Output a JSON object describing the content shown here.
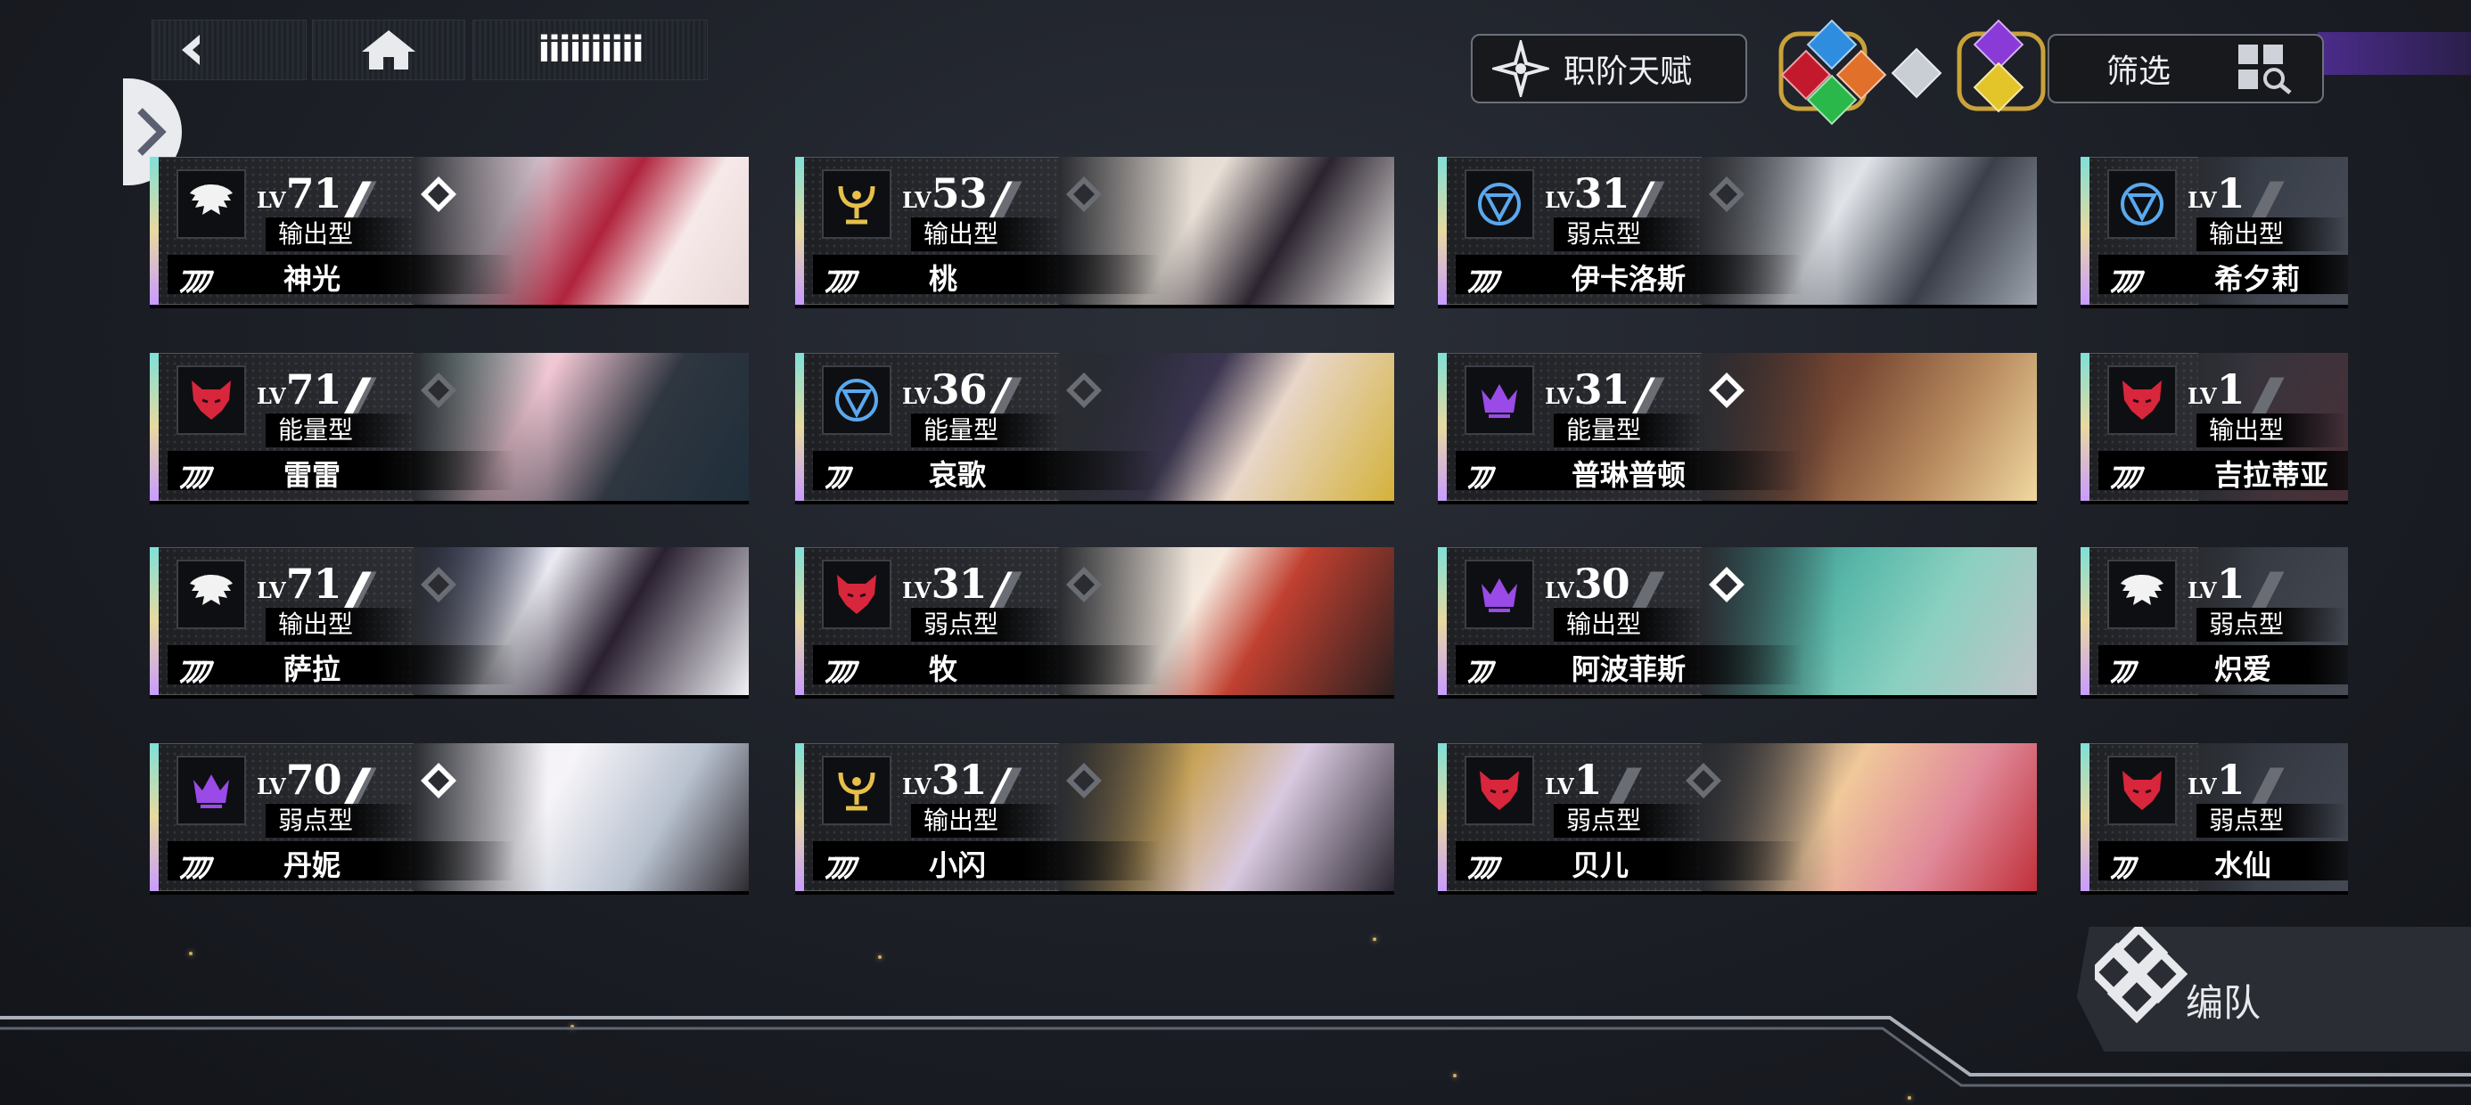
{
  "nav": {
    "title": "iiiiiiiiii"
  },
  "top": {
    "talent_label": "职阶天赋",
    "filter_label": "筛选"
  },
  "colors": {
    "rank_on": "#ffffff",
    "rank_off": "#6a6d74",
    "accent_purple": "#4c2c8c"
  },
  "elements": [
    "red-wolf-gem",
    "blue-gem",
    "orange-gem",
    "green-gem",
    "white-gem",
    "purple-gem",
    "yellow-gem"
  ],
  "cards": [
    {
      "lv_prefix": "LV",
      "level": "71",
      "role": "输出型",
      "name": "神光",
      "emblem": "wing-icon",
      "stars": "ﾌﾌﾌﾌ",
      "rank_on": 2,
      "rank": "filled"
    },
    {
      "lv_prefix": "LV",
      "level": "53",
      "role": "输出型",
      "name": "桃",
      "emblem": "chalice-icon",
      "stars": "ﾌﾌﾌﾌ",
      "rank_on": 1,
      "rank": "gray"
    },
    {
      "lv_prefix": "LV",
      "level": "31",
      "role": "弱点型",
      "name": "伊卡洛斯",
      "emblem": "shield-icon",
      "stars": "ﾌﾌﾌﾌ",
      "rank_on": 1,
      "rank": "gray"
    },
    {
      "lv_prefix": "LV",
      "level": "1",
      "role": "输出型",
      "name": "希夕莉",
      "emblem": "shield-icon",
      "stars": "ﾌﾌﾌﾌ",
      "rank_on": 0,
      "rank": "none"
    },
    {
      "lv_prefix": "LV",
      "level": "71",
      "role": "能量型",
      "name": "雷雷",
      "emblem": "wolf-icon",
      "stars": "ﾌﾌﾌﾌ",
      "rank_on": 2,
      "rank": "gray"
    },
    {
      "lv_prefix": "LV",
      "level": "36",
      "role": "能量型",
      "name": "哀歌",
      "emblem": "shield-icon",
      "stars": "ﾌﾌﾌ",
      "rank_on": 1,
      "rank": "gray"
    },
    {
      "lv_prefix": "LV",
      "level": "31",
      "role": "能量型",
      "name": "普琳普顿",
      "emblem": "crown-icon",
      "stars": "ﾌﾌﾌ",
      "rank_on": 1,
      "rank": "filled"
    },
    {
      "lv_prefix": "LV",
      "level": "1",
      "role": "输出型",
      "name": "吉拉蒂亚",
      "emblem": "wolf-icon",
      "stars": "ﾌﾌﾌﾌ",
      "rank_on": 0,
      "rank": "none"
    },
    {
      "lv_prefix": "LV",
      "level": "71",
      "role": "输出型",
      "name": "萨拉",
      "emblem": "wing-icon",
      "stars": "ﾌﾌﾌﾌ",
      "rank_on": 2,
      "rank": "gray"
    },
    {
      "lv_prefix": "LV",
      "level": "31",
      "role": "弱点型",
      "name": "牧",
      "emblem": "wolf-icon",
      "stars": "ﾌﾌﾌﾌ",
      "rank_on": 1,
      "rank": "gray"
    },
    {
      "lv_prefix": "LV",
      "level": "30",
      "role": "输出型",
      "name": "阿波菲斯",
      "emblem": "crown-icon",
      "stars": "ﾌﾌﾌ",
      "rank_on": 0,
      "rank": "filled"
    },
    {
      "lv_prefix": "LV",
      "level": "1",
      "role": "弱点型",
      "name": "炽爱",
      "emblem": "wing-icon",
      "stars": "ﾌﾌﾌ",
      "rank_on": 0,
      "rank": "none"
    },
    {
      "lv_prefix": "LV",
      "level": "70",
      "role": "弱点型",
      "name": "丹妮",
      "emblem": "crown-icon",
      "stars": "ﾌﾌﾌﾌ",
      "rank_on": 2,
      "rank": "filled"
    },
    {
      "lv_prefix": "LV",
      "level": "31",
      "role": "输出型",
      "name": "小闪",
      "emblem": "chalice-icon",
      "stars": "ﾌﾌﾌﾌ",
      "rank_on": 1,
      "rank": "gray"
    },
    {
      "lv_prefix": "LV",
      "level": "1",
      "role": "弱点型",
      "name": "贝儿",
      "emblem": "wolf-icon",
      "stars": "ﾌﾌﾌﾌ",
      "rank_on": 0,
      "rank": "gray"
    },
    {
      "lv_prefix": "LV",
      "level": "1",
      "role": "弱点型",
      "name": "水仙",
      "emblem": "wolf-icon",
      "stars": "ﾌﾌﾌ",
      "rank_on": 0,
      "rank": "none"
    }
  ],
  "formation": {
    "label": "编队"
  }
}
